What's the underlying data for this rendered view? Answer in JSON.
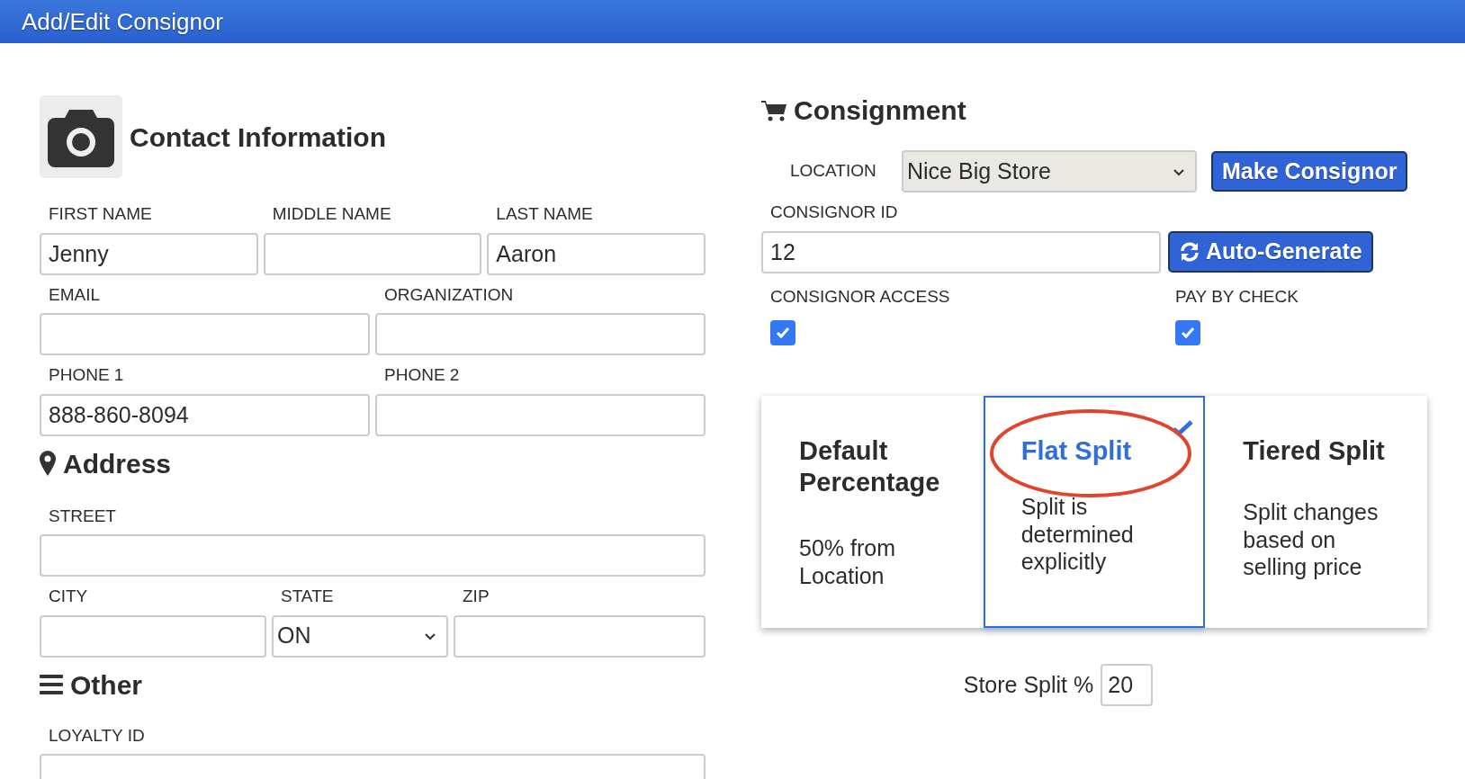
{
  "window": {
    "title": "Add/Edit Consignor"
  },
  "contact": {
    "title": "Contact Information",
    "rows": [
      [
        {
          "label": "FIRST NAME",
          "value": "Jenny",
          "kind": "text"
        },
        {
          "label": "MIDDLE NAME",
          "kind": "text"
        },
        {
          "label": "LAST NAME",
          "value": "Aaron",
          "kind": "text"
        }
      ],
      [
        {
          "label": "EMAIL",
          "kind": "text"
        },
        {
          "label": "ORGANIZATION",
          "kind": "text"
        }
      ],
      [
        {
          "label": "PHONE 1",
          "value": "888-860-8094",
          "kind": "text"
        },
        {
          "label": "PHONE 2",
          "kind": "text"
        }
      ]
    ]
  },
  "address": {
    "title": "Address",
    "rows": [
      [
        {
          "label": "STREET",
          "kind": "text"
        }
      ],
      [
        {
          "label": "CITY",
          "kind": "text"
        },
        {
          "label": "STATE",
          "value": "ON",
          "kind": "select"
        },
        {
          "label": "ZIP",
          "kind": "text"
        }
      ]
    ]
  },
  "other": {
    "title": "Other",
    "rows": [
      [
        {
          "label": "LOYALTY ID",
          "kind": "text"
        }
      ]
    ]
  },
  "consignment": {
    "title": "Consignment",
    "location_label": "LOCATION",
    "location": "Nice Big Store",
    "make_button": "Make Consignor",
    "id_label": "CONSIGNOR ID",
    "id_value": "12",
    "generate_button": "Auto-Generate",
    "checks": [
      {
        "label": "CONSIGNOR ACCESS",
        "checked": true
      },
      {
        "label": "PAY BY CHECK",
        "checked": true
      }
    ],
    "splits": [
      {
        "title": "Default Percentage",
        "text": "50% from Location",
        "selected": false,
        "highlighted": false
      },
      {
        "title": "Flat Split",
        "text": "Split is determined explicitly",
        "selected": true,
        "highlighted": true
      },
      {
        "title": "Tiered Split",
        "text": "Split changes based on selling price",
        "selected": false,
        "highlighted": false
      }
    ],
    "store_split_label": "Store Split %",
    "store_split_value": "20"
  }
}
